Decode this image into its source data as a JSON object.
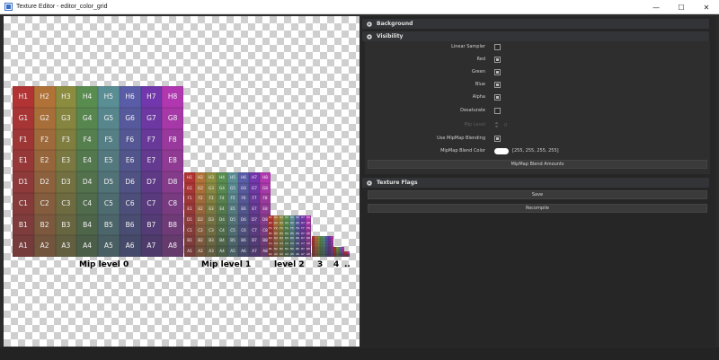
{
  "window": {
    "title": "Texture Editor - editor_color_grid",
    "minimize_glyph": "—",
    "maximize_glyph": "☐",
    "close_glyph": "✕"
  },
  "viewport": {
    "mips": [
      {
        "label": "Mip level 0",
        "size": 8,
        "names": true
      },
      {
        "label": "Mip level 1",
        "size": 8,
        "names": true
      },
      {
        "label": "level 2",
        "size": 8,
        "names": true
      },
      {
        "label": "3",
        "size": 8,
        "names": false
      },
      {
        "label": "4",
        "size": 4,
        "names": false
      },
      {
        "label": "..",
        "size": 2,
        "names": false
      }
    ],
    "rows": [
      "H",
      "G",
      "F",
      "E",
      "D",
      "C",
      "B",
      "A"
    ],
    "colors": {
      "top_left": "#b03030",
      "top_right": "#b040b0",
      "bottom_left": "#8a4040",
      "bottom_right": "#503a70"
    }
  },
  "panel": {
    "background": {
      "label": "Background",
      "expanded": false
    },
    "visibility": {
      "label": "Visibility",
      "expanded": true,
      "rows": [
        {
          "label": "Linear Sampler",
          "type": "checkbox",
          "checked": false
        },
        {
          "label": "Red",
          "type": "checkbox",
          "checked": true
        },
        {
          "label": "Green",
          "type": "checkbox",
          "checked": true
        },
        {
          "label": "Blue",
          "type": "checkbox",
          "checked": true
        },
        {
          "label": "Alpha",
          "type": "checkbox",
          "checked": true
        },
        {
          "label": "Desaturate",
          "type": "checkbox",
          "checked": false
        },
        {
          "label": "Mip Level",
          "type": "spinner",
          "value": "0",
          "disabled": true
        },
        {
          "label": "Use MipMap Blending",
          "type": "checkbox",
          "checked": true
        },
        {
          "label": "MipMap Blend Color",
          "type": "color",
          "value": "[255, 255, 255, 255]"
        }
      ],
      "blend_amounts_button": "MipMap Blend Amounts"
    },
    "texture_flags": {
      "label": "Texture Flags",
      "expanded": false
    },
    "save_button": "Save",
    "recompile_button": "Recompile"
  }
}
